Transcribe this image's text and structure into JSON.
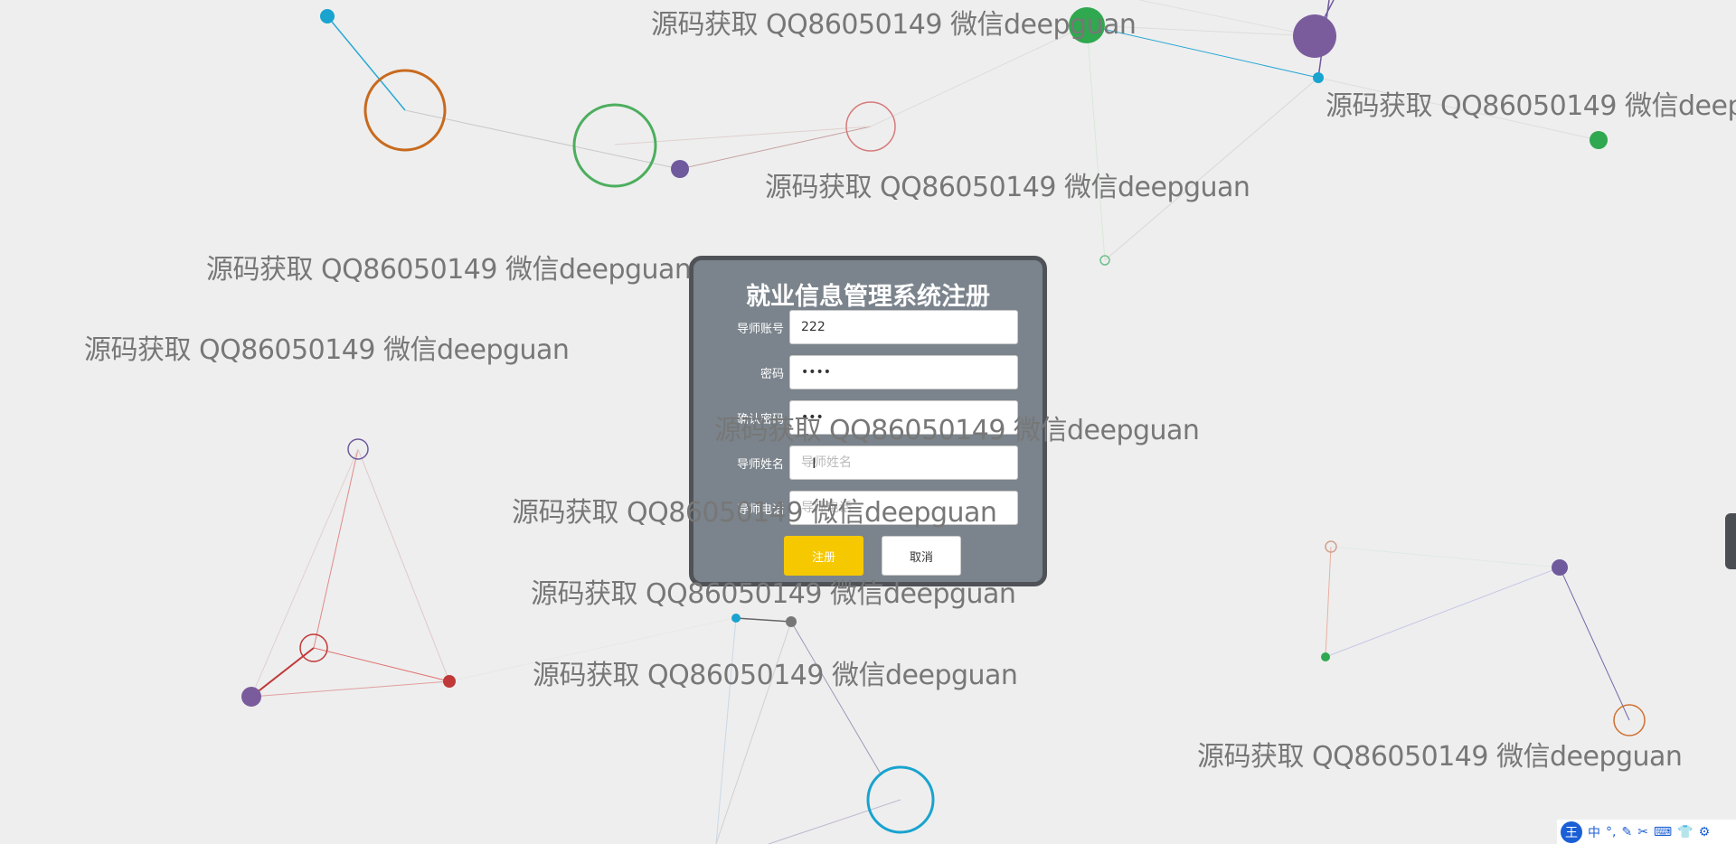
{
  "watermark_text": "源码获取 QQ86050149 微信deepguan",
  "dialog": {
    "title": "就业信息管理系统注册",
    "fields": [
      {
        "label": "导师账号",
        "value": "222",
        "placeholder": "",
        "type": "text"
      },
      {
        "label": "密码",
        "value": "2222",
        "placeholder": "",
        "type": "password"
      },
      {
        "label": "确认密码",
        "value": "222",
        "placeholder": "",
        "type": "password"
      },
      {
        "label": "导师姓名",
        "value": "",
        "placeholder": "导师姓名",
        "type": "text"
      },
      {
        "label": "导师电话",
        "value": "",
        "placeholder": "导师电话",
        "type": "text"
      }
    ],
    "submit_label": "注册",
    "cancel_label": "取消"
  },
  "ime": {
    "logo": "王",
    "items": [
      "中",
      "°,",
      "✎",
      "✂",
      "⌨",
      "👕",
      "⚙"
    ]
  },
  "colors": {
    "background": "#eeeeee",
    "dialog_bg": "#7b848c",
    "dialog_border": "#4f5358",
    "primary_button": "#f5c800",
    "watermark": "#777777"
  }
}
